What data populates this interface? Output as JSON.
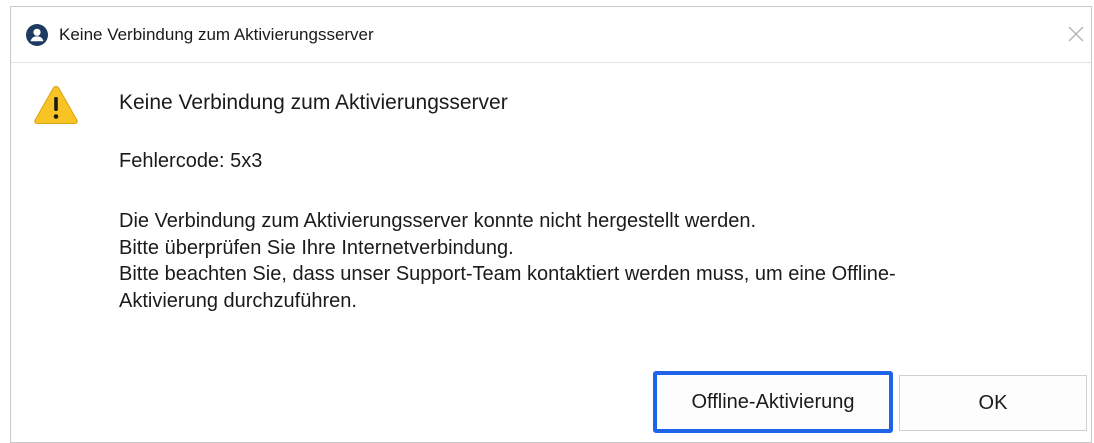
{
  "window": {
    "title": "Keine Verbindung zum Aktivierungsserver",
    "title_icon": "user-circle-icon",
    "close_icon": "close-icon"
  },
  "dialog": {
    "icon": "warning-icon",
    "heading": "Keine Verbindung zum Aktivierungsserver",
    "error_code": "Fehlercode: 5x3",
    "message_lines": [
      "Die Verbindung zum Aktivierungsserver konnte nicht hergestellt werden.",
      "Bitte überprüfen Sie Ihre Internetverbindung.",
      "Bitte beachten Sie, dass unser Support-Team kontaktiert werden muss, um eine Offline-",
      "Aktivierung durchzuführen."
    ]
  },
  "buttons": {
    "offline_label": "Offline-Aktivierung",
    "ok_label": "OK"
  },
  "colors": {
    "focus_border": "#1f64e8",
    "title_icon": "#1e3a5f",
    "warning_fill": "#f7c325"
  }
}
